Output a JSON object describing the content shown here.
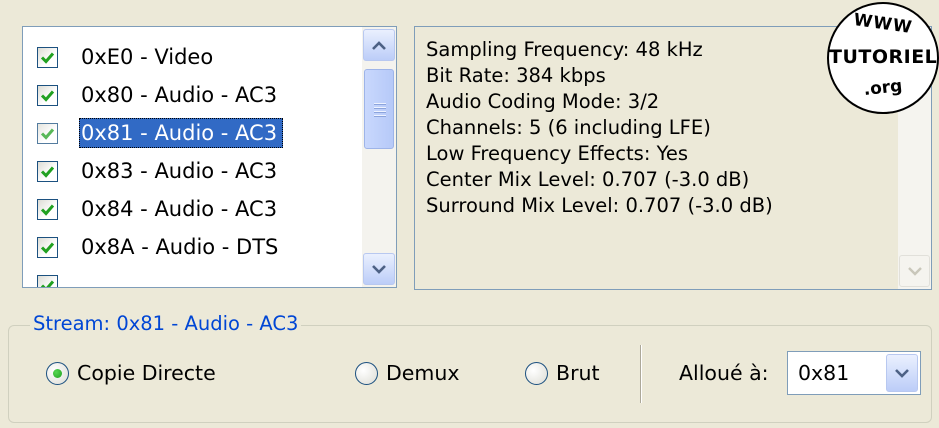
{
  "streams": [
    {
      "label": "0xE0 - Video",
      "checked": true,
      "selected": false
    },
    {
      "label": "0x80 - Audio - AC3",
      "checked": true,
      "selected": false
    },
    {
      "label": "0x81 - Audio - AC3",
      "checked": true,
      "selected": true
    },
    {
      "label": "0x83 - Audio - AC3",
      "checked": true,
      "selected": false
    },
    {
      "label": "0x84 - Audio - AC3",
      "checked": true,
      "selected": false
    },
    {
      "label": "0x8A - Audio - DTS",
      "checked": true,
      "selected": false
    }
  ],
  "info": [
    "Sampling Frequency: 48 kHz",
    "Bit Rate: 384 kbps",
    "Audio Coding Mode: 3/2",
    "Channels: 5 (6 including LFE)",
    "Low Frequency Effects: Yes",
    "Center Mix Level: 0.707 (-3.0 dB)",
    "Surround Mix Level: 0.707 (-3.0 dB)"
  ],
  "watermark": {
    "top": "WWW",
    "middle": "TUTORIEL",
    "bottom": ".org"
  },
  "stream_group": {
    "legend": "Stream: 0x81 - Audio - AC3",
    "options": [
      {
        "label": "Copie Directe",
        "selected": true
      },
      {
        "label": "Demux",
        "selected": false
      },
      {
        "label": "Brut",
        "selected": false
      }
    ],
    "allocated_label": "Alloué à:",
    "allocated_value": "0x81"
  },
  "icons": {
    "checkbox": "check-icon",
    "scroll_up": "chevron-up-icon",
    "scroll_down": "chevron-down-icon",
    "dropdown": "chevron-down-icon"
  },
  "colors": {
    "selection": "#316ac5",
    "legend": "#0046d5",
    "check": "#21a121",
    "window": "#ece9d8"
  }
}
